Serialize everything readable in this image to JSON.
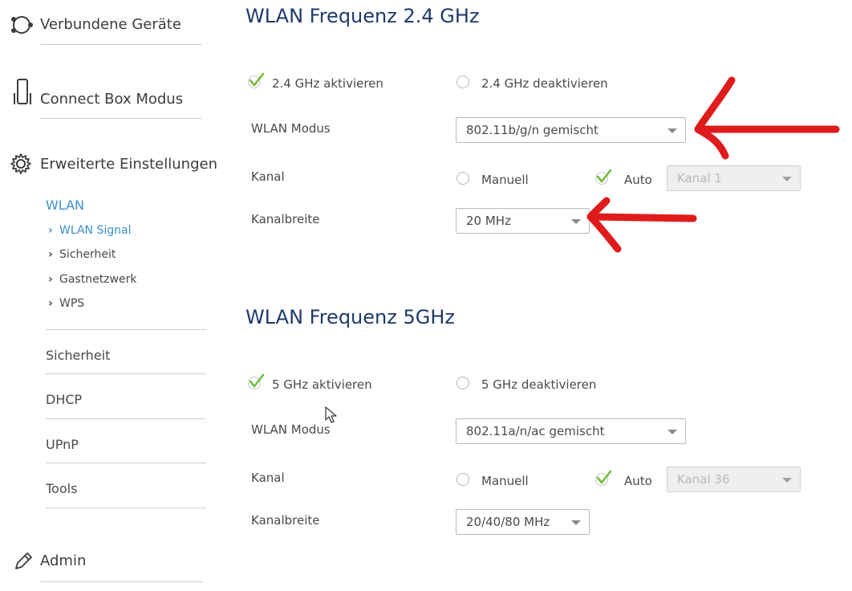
{
  "sidebar": {
    "main_items": [
      {
        "label": "Verbundene Geräte",
        "icon": "devices-icon"
      },
      {
        "label": "Connect Box Modus",
        "icon": "phone-icon"
      },
      {
        "label": "Erweiterte Einstellungen",
        "icon": "gear-icon"
      }
    ],
    "wlan": {
      "title": "WLAN",
      "subitems": [
        "WLAN Signal",
        "Sicherheit",
        "Gastnetzwerk",
        "WPS"
      ]
    },
    "links": [
      "Sicherheit",
      "DHCP",
      "UPnP",
      "Tools"
    ],
    "admin": {
      "label": "Admin",
      "icon": "pencil-icon"
    }
  },
  "band24": {
    "title": "WLAN Frequenz 2.4 GHz",
    "enable_label": "2.4 GHz aktivieren",
    "disable_label": "2.4 GHz deaktivieren",
    "mode_label": "WLAN Modus",
    "mode_value": "802.11b/g/n gemischt",
    "channel_label": "Kanal",
    "manual_label": "Manuell",
    "auto_label": "Auto",
    "channel_value": "Kanal 1",
    "bandwidth_label": "Kanalbreite",
    "bandwidth_value": "20 MHz"
  },
  "band5": {
    "title": "WLAN Frequenz 5GHz",
    "enable_label": "5 GHz aktivieren",
    "disable_label": "5 GHz deaktivieren",
    "mode_label": "WLAN Modus",
    "mode_value": "802.11a/n/ac gemischt",
    "channel_label": "Kanal",
    "manual_label": "Manuell",
    "auto_label": "Auto",
    "channel_value": "Kanal 36",
    "bandwidth_label": "Kanalbreite",
    "bandwidth_value": "20/40/80 MHz"
  },
  "colors": {
    "accent": "#3a8fd0",
    "title": "#1f3a6b",
    "check": "#6fbf3a",
    "annotation": "#e01b1b"
  }
}
